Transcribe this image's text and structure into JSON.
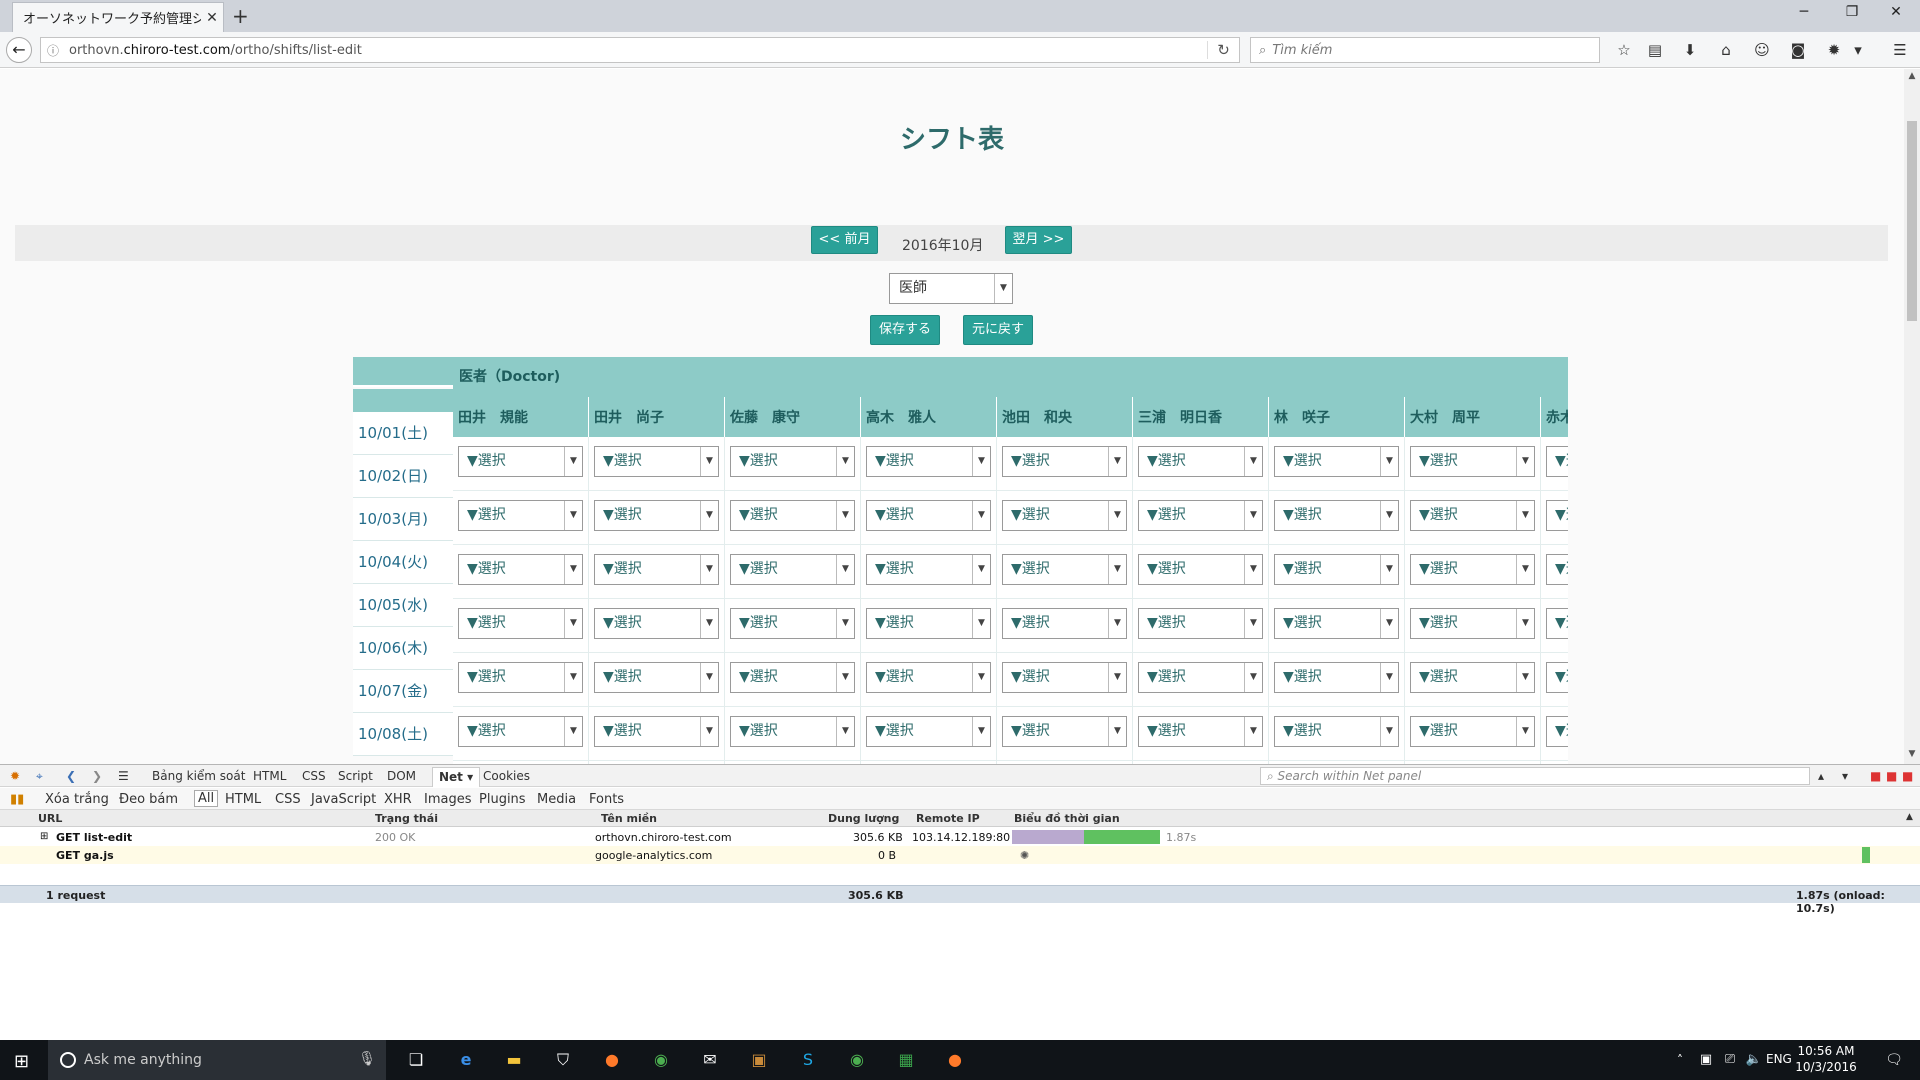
{
  "browser": {
    "tab_title": "オーソネットワーク予約管理シ...",
    "url_domain": "orthovn.",
    "url_host": "chiroro-test.com",
    "url_path": "/ortho/shifts/list-edit",
    "search_placeholder": "Tìm kiếm"
  },
  "page": {
    "title": "シフト表",
    "prev_month": "<< 前月",
    "current_month": "2016年10月",
    "next_month": "翌月 >>",
    "role_select_value": "医師",
    "save_label": "保存する",
    "revert_label": "元に戻す"
  },
  "table": {
    "group_header": "医者（Doctor)",
    "select_placeholder": "▼選択",
    "staff": [
      "田井　規能",
      "田井　尚子",
      "佐藤　康守",
      "高木　雅人",
      "池田　和央",
      "三浦　明日香",
      "林　咲子",
      "大村　周平",
      "赤木"
    ],
    "dates": [
      "10/01(土)",
      "10/02(日)",
      "10/03(月)",
      "10/04(火)",
      "10/05(水)",
      "10/06(木)",
      "10/07(金)",
      "10/08(土)"
    ]
  },
  "devtools": {
    "tabs": [
      "Bảng kiểm soát",
      "HTML",
      "CSS",
      "Script",
      "DOM",
      "Net ▾",
      "Cookies"
    ],
    "search_placeholder": "Search within Net panel",
    "filter_actions": [
      "Xóa trắng",
      "Đeo bám"
    ],
    "filters": [
      "All",
      "HTML",
      "CSS",
      "JavaScript",
      "XHR",
      "Images",
      "Plugins",
      "Media",
      "Fonts"
    ],
    "columns": {
      "url": "URL",
      "status": "Trạng thái",
      "domain": "Tên miền",
      "size": "Dung lượng",
      "remote_ip": "Remote IP",
      "timeline": "Biểu đồ thời gian"
    },
    "requests": [
      {
        "url": "GET list-edit",
        "status": "200 OK",
        "domain": "orthovn.chiroro-test.com",
        "size": "305.6 KB",
        "ip": "103.14.12.189:80",
        "time": "1.87s"
      },
      {
        "url": "GET ga.js",
        "status": "",
        "domain": "google-analytics.com",
        "size": "0 B",
        "ip": "",
        "time": ""
      }
    ],
    "summary": {
      "count": "1 request",
      "size": "305.6 KB",
      "timing": "1.87s (onload: 10.7s)"
    }
  },
  "taskbar": {
    "search_placeholder": "Ask me anything",
    "language": "ENG",
    "time": "10:56 AM",
    "date": "10/3/2016"
  },
  "colors": {
    "accent": "#2aa198",
    "header": "#8dcbc7",
    "header_text": "#1e5d5d"
  }
}
